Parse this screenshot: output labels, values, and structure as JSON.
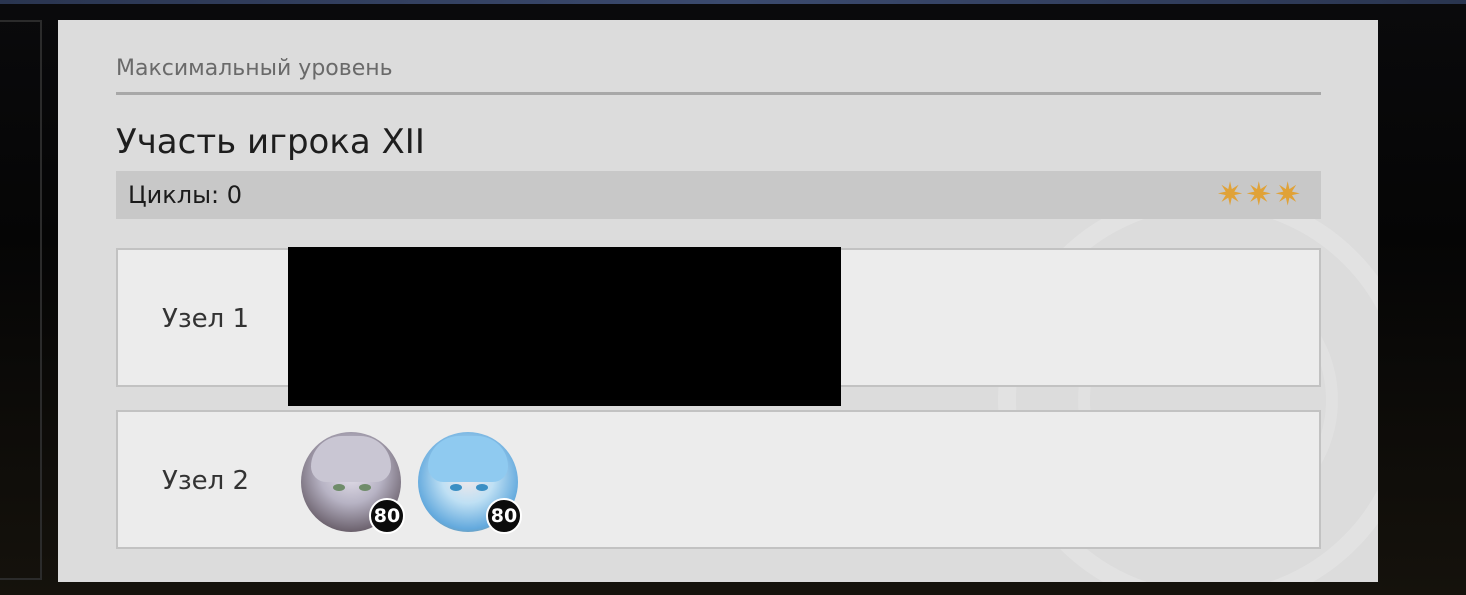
{
  "header": {
    "subtitle": "Максимальный уровень",
    "title": "Участь игрока XII"
  },
  "cycles": {
    "label": "Циклы: 0",
    "stars": "✷✷✷",
    "star_count": 3,
    "star_color": "#e0a238"
  },
  "nodes": [
    {
      "label": "Узел 1",
      "characters": []
    },
    {
      "label": "Узел 2",
      "characters": [
        {
          "icon": "character-avatar-silver-hair",
          "level": "80"
        },
        {
          "icon": "character-avatar-blue-hair",
          "level": "80"
        }
      ]
    }
  ]
}
